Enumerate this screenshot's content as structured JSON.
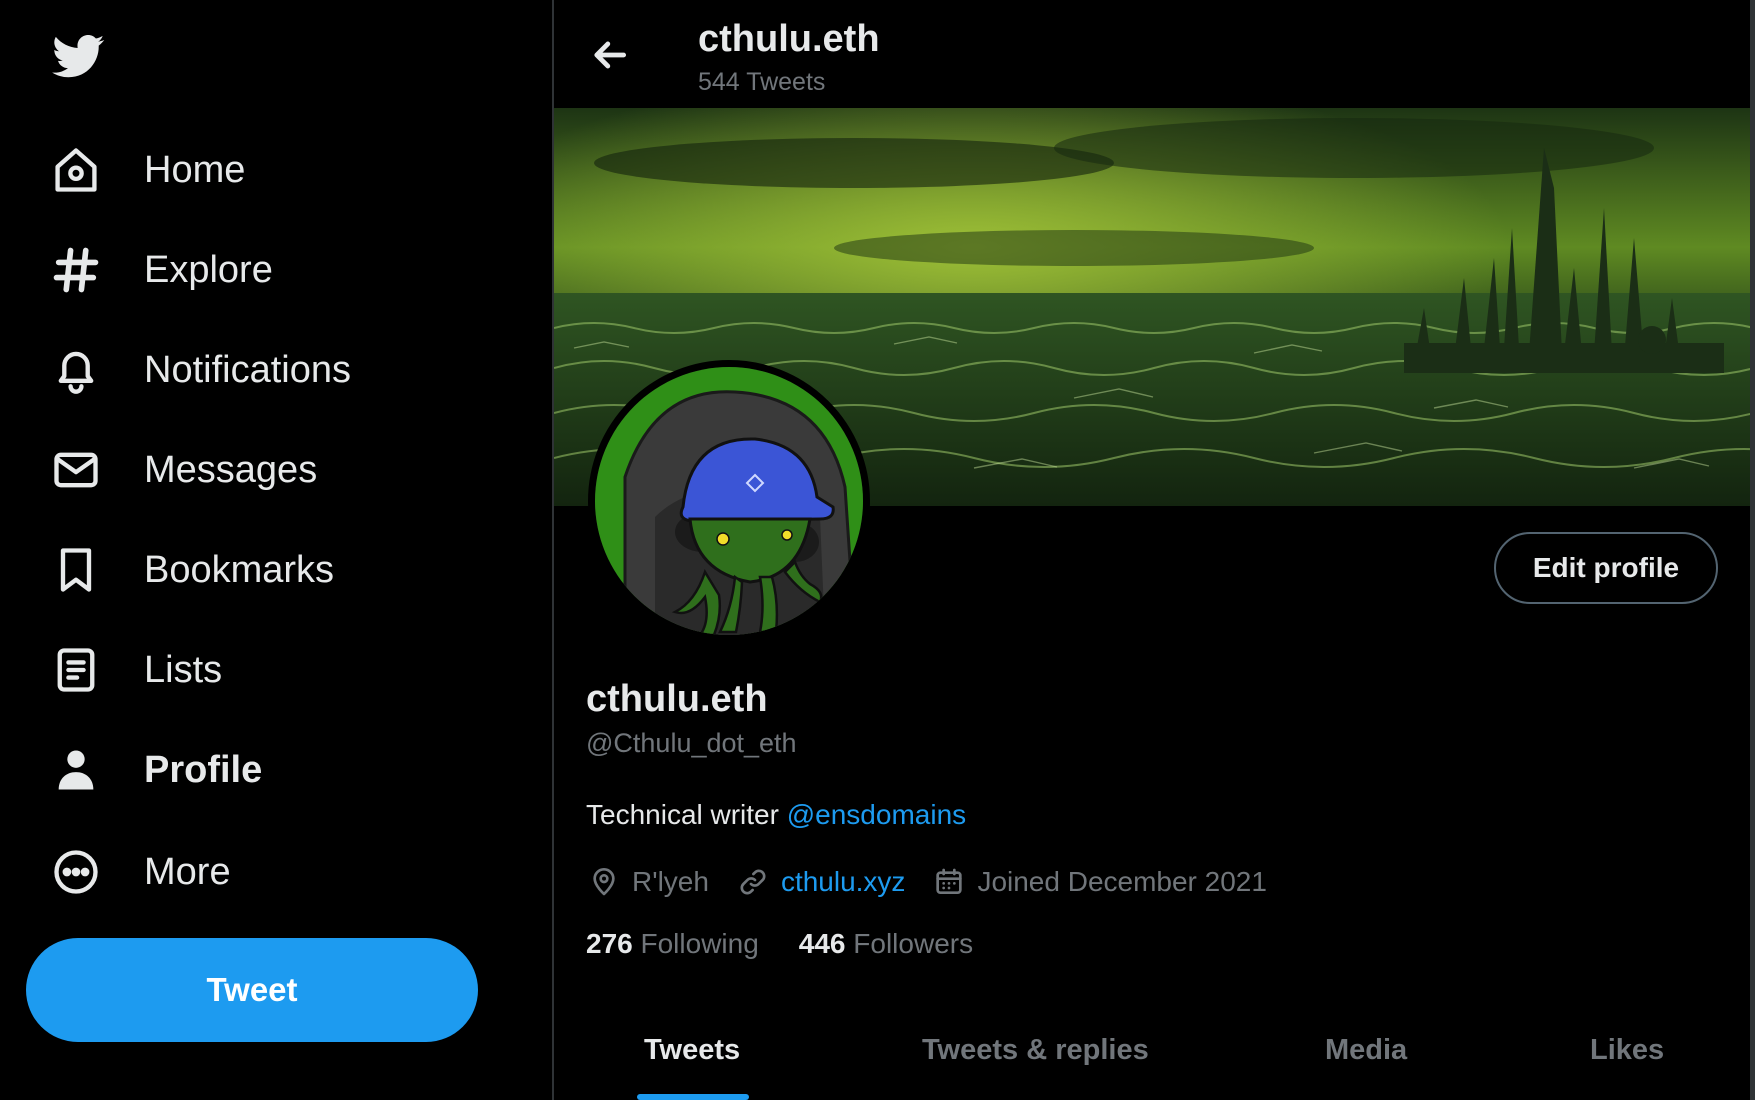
{
  "sidebar": {
    "items": [
      {
        "label": "Home",
        "icon": "home-icon"
      },
      {
        "label": "Explore",
        "icon": "hashtag-icon"
      },
      {
        "label": "Notifications",
        "icon": "bell-icon"
      },
      {
        "label": "Messages",
        "icon": "envelope-icon"
      },
      {
        "label": "Bookmarks",
        "icon": "bookmark-icon"
      },
      {
        "label": "Lists",
        "icon": "list-icon"
      },
      {
        "label": "Profile",
        "icon": "person-icon"
      },
      {
        "label": "More",
        "icon": "more-circle-icon"
      }
    ],
    "active": "Profile",
    "tweet_label": "Tweet"
  },
  "header": {
    "title": "cthulu.eth",
    "tweet_count": "544 Tweets"
  },
  "profile": {
    "name": "cthulu.eth",
    "handle": "@Cthulu_dot_eth",
    "bio_text": "Technical writer",
    "bio_mention": "@ensdomains",
    "location": "R'lyeh",
    "website": "cthulu.xyz",
    "joined": "Joined December 2021",
    "following_count": "276",
    "following_label": "Following",
    "followers_count": "446",
    "followers_label": "Followers",
    "edit_label": "Edit profile"
  },
  "tabs": [
    "Tweets",
    "Tweets & replies",
    "Media",
    "Likes"
  ],
  "active_tab": "Tweets",
  "colors": {
    "accent": "#1d9bf0",
    "background": "#000000",
    "text": "#e7e9ea",
    "secondary_text": "#71767b"
  }
}
